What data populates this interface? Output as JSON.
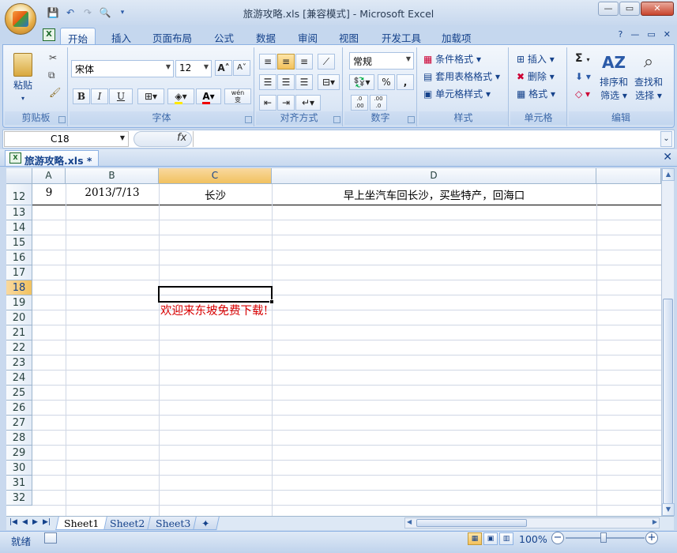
{
  "window": {
    "title": "旅游攻略.xls  [兼容模式] - Microsoft Excel",
    "minimize": "—",
    "restore": "▭",
    "close": "✕"
  },
  "qat": {
    "save": "💾",
    "undo": "↶",
    "redo": "↷",
    "preview": "🔍",
    "more": "▾"
  },
  "ribbon_tabs": [
    "开始",
    "插入",
    "页面布局",
    "公式",
    "数据",
    "审阅",
    "视图",
    "开发工具",
    "加载项"
  ],
  "ribbon_right": {
    "help": "?",
    "min": "—",
    "restore": "▭",
    "close": "✕"
  },
  "clipboard": {
    "paste": "粘贴",
    "label": "剪贴板"
  },
  "font": {
    "name": "宋体",
    "size": "12",
    "bold": "B",
    "italic": "I",
    "underline": "U",
    "grow": "A",
    "shrink": "A",
    "label": "字体",
    "phonetic": "wén"
  },
  "alignment": {
    "label": "对齐方式"
  },
  "number": {
    "format": "常规",
    "percent": "%",
    "comma": ",",
    "inc": ".0 .00",
    "dec": ".00 .0",
    "label": "数字"
  },
  "styles": {
    "conditional": "条件格式",
    "table": "套用表格格式",
    "cell": "单元格样式",
    "label": "样式"
  },
  "cells": {
    "insert": "插入",
    "delete": "删除",
    "format": "格式",
    "label": "单元格"
  },
  "editing": {
    "sum": "Σ",
    "sort": "排序和",
    "sort2": "筛选",
    "find": "查找和",
    "find2": "选择",
    "label": "编辑"
  },
  "formula_bar": {
    "name_box": "C18",
    "fx": "fx",
    "value": ""
  },
  "doc_tab": {
    "name": "旅游攻略.xls *"
  },
  "columns": [
    {
      "label": "A"
    },
    {
      "label": "B"
    },
    {
      "label": "C"
    },
    {
      "label": "D"
    }
  ],
  "rows": [
    {
      "num": "12",
      "a": "9",
      "b": "2013/7/13",
      "c": "长沙",
      "d": "早上坐汽车回长沙，买些特产，回海口"
    },
    {
      "num": "13"
    },
    {
      "num": "14"
    },
    {
      "num": "15"
    },
    {
      "num": "16"
    },
    {
      "num": "17"
    },
    {
      "num": "18"
    },
    {
      "num": "19"
    },
    {
      "num": "20"
    },
    {
      "num": "21"
    },
    {
      "num": "22"
    },
    {
      "num": "23"
    },
    {
      "num": "24"
    },
    {
      "num": "25"
    },
    {
      "num": "26"
    },
    {
      "num": "27"
    },
    {
      "num": "28"
    },
    {
      "num": "29"
    },
    {
      "num": "30"
    },
    {
      "num": "31"
    },
    {
      "num": "32"
    }
  ],
  "overlay_text": "欢迎来东坡免费下载!",
  "selected_cell": "C18",
  "sheets": [
    "Sheet1",
    "Sheet2",
    "Sheet3"
  ],
  "active_sheet": "Sheet1",
  "status": {
    "ready": "就绪",
    "zoom": "100%",
    "zoom_minus": "−",
    "zoom_plus": "+"
  },
  "colors": {
    "accent": "#15428b",
    "selection_header": "#f1c15f",
    "red_text": "#d80000"
  }
}
